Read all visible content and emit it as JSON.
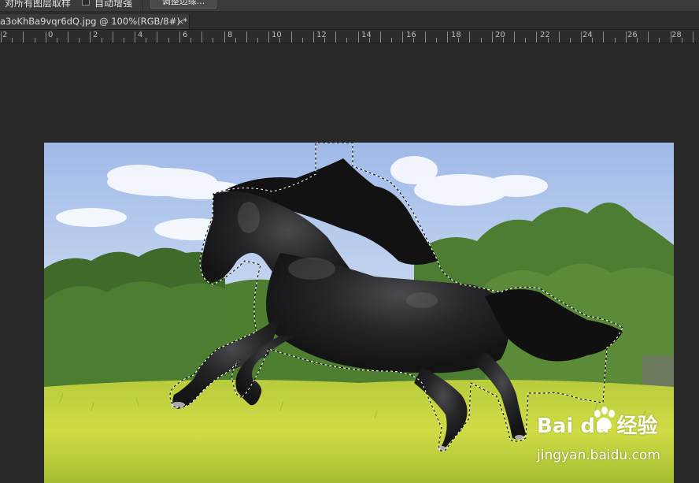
{
  "options_bar": {
    "sample_all_layers_label": "对所有图层取样",
    "auto_enhance_label": "自动增强",
    "refine_edge_label": "调整边缘..."
  },
  "document_tab": {
    "title": "a3oKhBa9vqr6dQ.jpg @ 100%(RGB/8#) *",
    "close_glyph": "×"
  },
  "ruler": {
    "labels": [
      "2",
      "0",
      "2",
      "4",
      "6",
      "8",
      "10",
      "12",
      "14",
      "16",
      "18",
      "20",
      "22",
      "24",
      "26",
      "28"
    ]
  },
  "watermark": {
    "brand": "Bai du 经验",
    "url": "jingyan.baidu.com"
  },
  "icons": {
    "paw": "paw-icon",
    "close": "close-icon"
  },
  "colors": {
    "workspace_bg": "#282828",
    "options_bar_bg": "#3b3b3b",
    "tab_bg": "#3a3a3a",
    "selection_marquee": "#ffffff"
  }
}
